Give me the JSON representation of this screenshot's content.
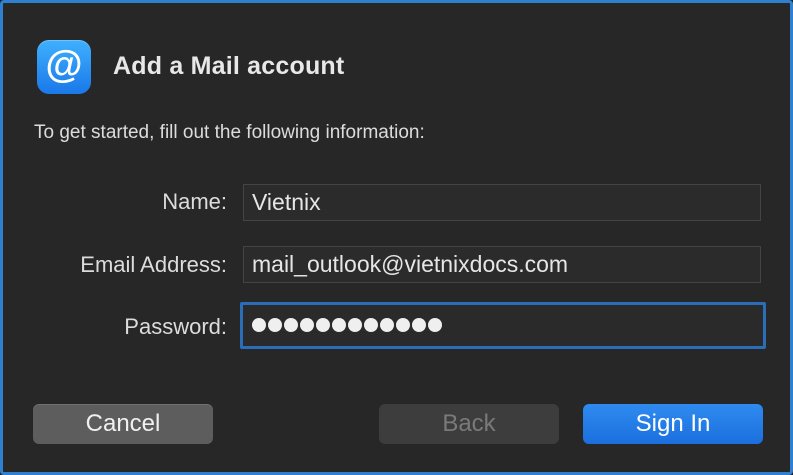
{
  "dialog": {
    "title": "Add a Mail account",
    "instructions": "To get started, fill out the following information:",
    "icon": "at-sign-icon",
    "accent_color": "#2f80d1"
  },
  "form": {
    "name_label": "Name:",
    "name_value": "Vietnix",
    "email_label": "Email Address:",
    "email_value": "mail_outlook@vietnixdocs.com",
    "password_label": "Password:",
    "password_masked": "●●●●●●●●●●●●"
  },
  "buttons": {
    "cancel_label": "Cancel",
    "back_label": "Back",
    "signin_label": "Sign In",
    "signin_color": "#1b6fdd"
  }
}
